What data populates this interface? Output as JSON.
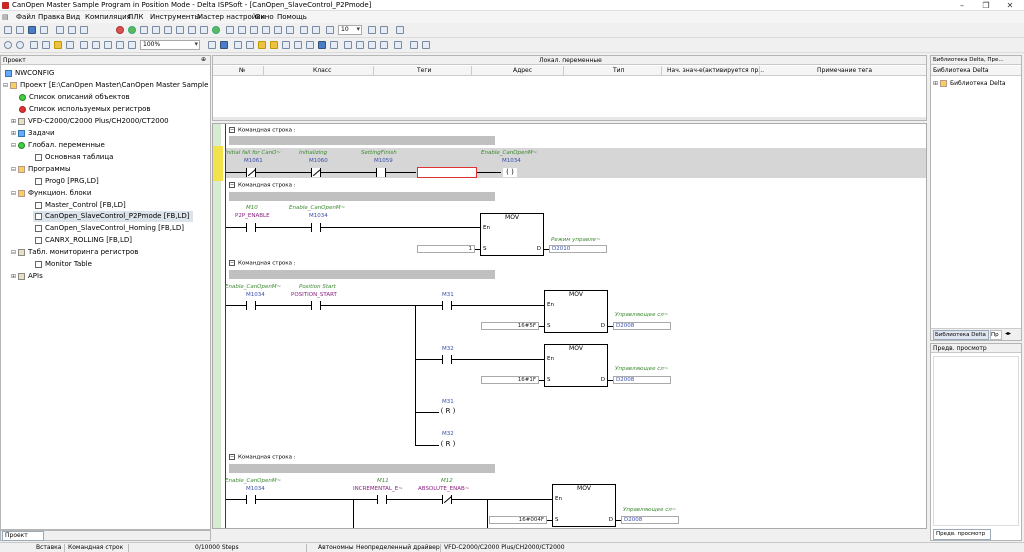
{
  "window": {
    "title": "CanOpen Master Sample Program in Position Mode - Delta ISPSoft - [CanOpen_SlaveControl_P2Pmode]"
  },
  "menu": [
    "Файл",
    "Правка",
    "Вид",
    "Компиляция",
    "ПЛК",
    "Инструменты",
    "Мастер настройки",
    "Окно",
    "Помощь"
  ],
  "toolbar": {
    "step_value": "10",
    "zoom": "100%"
  },
  "project_panel": {
    "title": "Проект",
    "tab": "Проект",
    "items": [
      {
        "label": "NWCONFIG"
      },
      {
        "label": "Проект [E:\\CanOpen Master\\CanOpen Master Sample"
      },
      {
        "label": "Список описаний объектов"
      },
      {
        "label": "Список используемых регистров"
      },
      {
        "label": "VFD-C2000/C2000 Plus/CH2000/CT2000"
      },
      {
        "label": "Задачи"
      },
      {
        "label": "Глобал. переменные"
      },
      {
        "label": "Основная таблица"
      },
      {
        "label": "Программы"
      },
      {
        "label": "Prog0 [PRG,LD]"
      },
      {
        "label": "Функцион. блоки"
      },
      {
        "label": "Master_Control [FB,LD]"
      },
      {
        "label": "CanOpen_SlaveControl_P2Pmode [FB,LD]"
      },
      {
        "label": "CanOpen_SlaveControl_Homing [FB,LD]"
      },
      {
        "label": "CANRX_ROLLING [FB,LD]"
      },
      {
        "label": "Табл. мониторинга регистров"
      },
      {
        "label": "Monitor Table"
      },
      {
        "label": "APIs"
      }
    ]
  },
  "local_vars": {
    "title": "Локал. переменные",
    "columns": [
      "№",
      "Класс",
      "Теги",
      "Адрес",
      "Тип",
      "Нач. знач-е(активируется пр...",
      "Примечание тега"
    ]
  },
  "ladder": {
    "row_header": "Командная строка :",
    "net1": {
      "c1_label": "Initial fail for CanO~",
      "c1_addr": "M1061",
      "c2_label": "Initializing",
      "c2_addr": "M1060",
      "c3_label": "SettingFinish",
      "c3_addr": "M1059",
      "coil_label": "Enable_CanOpenM~",
      "coil_addr": "M1034",
      "coil_sym": "( )"
    },
    "net2": {
      "c1_label": "M10",
      "c1_addr": "P2P_ENABLE",
      "c2_label": "Enable_CanOpenM~",
      "c2_addr": "M1034",
      "fb_name": "MOV",
      "en": "En",
      "s": "S",
      "d": "D",
      "s_val": "1",
      "d_label": "Режим управле~",
      "d_val": "D2010"
    },
    "net3": {
      "c1_label": "Enable_CanOpenM~",
      "c1_addr": "M1034",
      "c2_label": "Position Start",
      "c2_addr": "POSITION_START",
      "b1_addr": "M31",
      "b1_fb": "MOV",
      "b1_s": "16#5F",
      "b1_dlabel": "Управляющее сл~",
      "b1_d": "D2008",
      "b2_addr": "M32",
      "b2_fb": "MOV",
      "b2_s": "16#1F",
      "b2_dlabel": "Управляющее сл~",
      "b2_d": "D2008",
      "r1_addr": "M31",
      "r1_sym": "( R )",
      "r2_addr": "M32",
      "r2_sym": "( R )"
    },
    "net4": {
      "c1_label": "Enable_CanOpenM~",
      "c1_addr": "M1034",
      "c2_label": "M11",
      "c2_addr": "INCREMENTAL_E~",
      "c3_label": "M12",
      "c3_addr": "ABSOLUTE_ENAB~",
      "fb_name": "MOV",
      "s_val": "16#004F",
      "d_label": "Управляющее сл~",
      "d_val": "D2008"
    }
  },
  "library_panel": {
    "title": "Библиотека Delta, Пре...",
    "header": "Библиотека Delta",
    "item": "Библиотека Delta",
    "tab1": "Библиотека Delta",
    "tab2": "Пр"
  },
  "preview_panel": {
    "title": "Предв. просмотр",
    "tab": "Предв. просмотр"
  },
  "status": {
    "insert": "Вставка",
    "cmd": "Командная строк",
    "steps": "0/10000 Steps",
    "mode": "Автономны",
    "driver": "Неопределенный драйвер",
    "device": "VFD-C2000/C2000 Plus/CH2000/CT2000"
  }
}
